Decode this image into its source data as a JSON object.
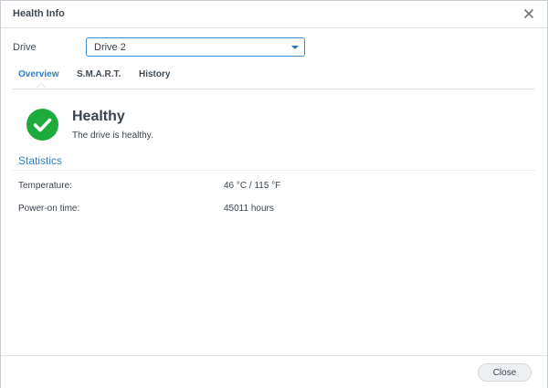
{
  "window": {
    "title": "Health Info",
    "close_icon": "close-icon"
  },
  "drive_selector": {
    "label": "Drive",
    "selected": "Drive 2",
    "caret_icon": "chevron-down-icon",
    "accent_color": "#3f8fd6"
  },
  "tabs": [
    {
      "label": "Overview",
      "active": true
    },
    {
      "label": "S.M.A.R.T.",
      "active": false
    },
    {
      "label": "History",
      "active": false
    }
  ],
  "status": {
    "icon": "check-circle-icon",
    "color": "#1fab3c",
    "title": "Healthy",
    "description": "The drive is healthy."
  },
  "statistics": {
    "title": "Statistics",
    "rows": [
      {
        "label": "Temperature:",
        "value": "46 °C / 115 °F"
      },
      {
        "label": "Power-on time:",
        "value": "45011 hours"
      }
    ]
  },
  "footer": {
    "close_label": "Close"
  }
}
